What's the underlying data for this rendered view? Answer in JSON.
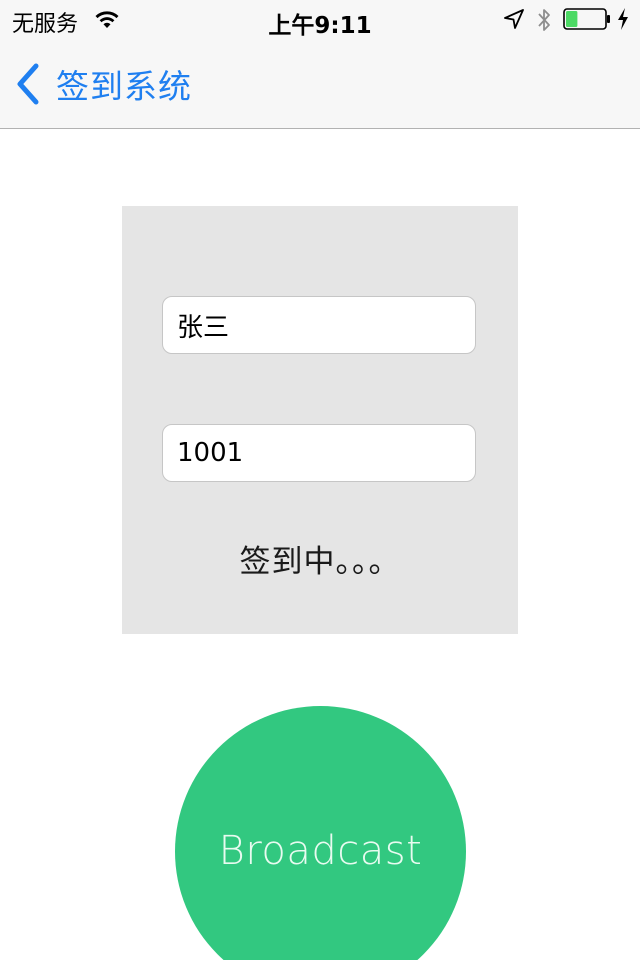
{
  "status_bar": {
    "carrier": "无服务",
    "time": "上午9:11",
    "battery_level": 0.3,
    "battery_color": "#4cd964"
  },
  "nav": {
    "back_label": "签到系统",
    "tint_color": "#1f7ff0"
  },
  "form": {
    "name_value": "张三",
    "id_value": "1001",
    "status_text": "签到中。。。"
  },
  "broadcast": {
    "label": "Broadcast",
    "color": "#32c880"
  },
  "icons": [
    "wifi-icon",
    "location-icon",
    "bluetooth-icon",
    "battery-icon",
    "charging-icon",
    "back-chevron-icon"
  ]
}
